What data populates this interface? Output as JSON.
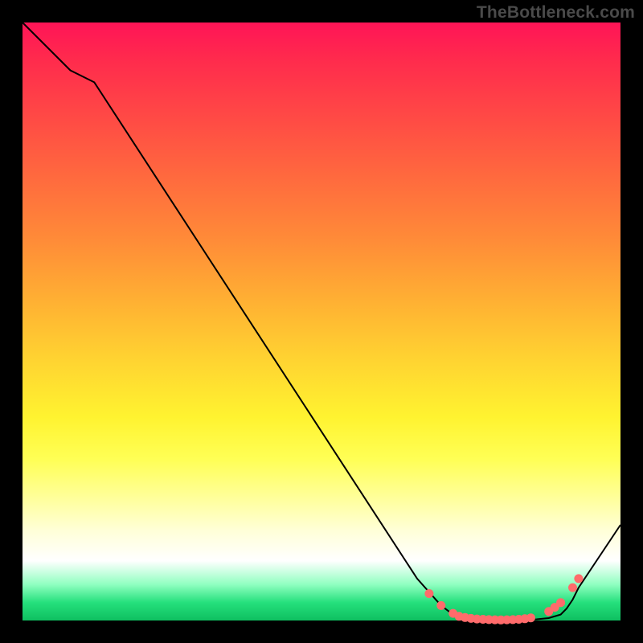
{
  "watermark": "TheBottleneck.com",
  "chart_data": {
    "type": "line",
    "title": "",
    "xlabel": "",
    "ylabel": "",
    "xlim": [
      0,
      100
    ],
    "ylim": [
      0,
      100
    ],
    "series": [
      {
        "name": "curve",
        "x": [
          0,
          8,
          12,
          66,
          70,
          72,
          74,
          76,
          78,
          80,
          82,
          84,
          86,
          88,
          90,
          91,
          92,
          93,
          100
        ],
        "values": [
          100,
          92,
          90,
          7,
          2.5,
          1.0,
          0.4,
          0.2,
          0.1,
          0.1,
          0.1,
          0.1,
          0.2,
          0.4,
          1.0,
          2.0,
          3.5,
          5.5,
          16
        ]
      }
    ],
    "markers": {
      "name": "dots",
      "color": "#ff6b6b",
      "x": [
        68,
        70,
        72,
        73,
        74,
        75,
        76,
        77,
        78,
        79,
        80,
        81,
        82,
        83,
        84,
        85,
        88,
        89,
        90,
        92,
        93
      ],
      "values": [
        4.5,
        2.5,
        1.2,
        0.7,
        0.5,
        0.35,
        0.25,
        0.2,
        0.15,
        0.12,
        0.1,
        0.12,
        0.15,
        0.2,
        0.3,
        0.45,
        1.5,
        2.2,
        3.0,
        5.5,
        7.0
      ]
    }
  }
}
